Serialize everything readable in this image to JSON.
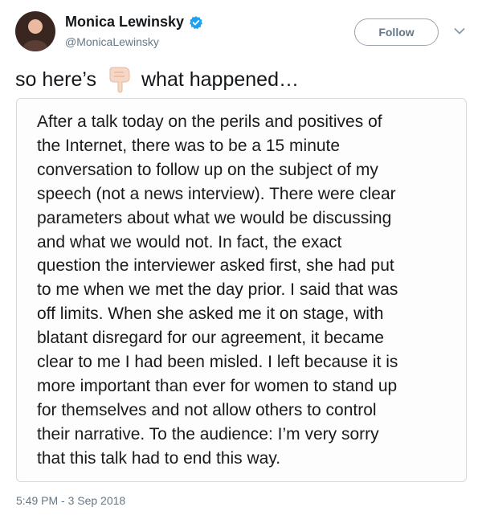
{
  "user": {
    "display_name": "Monica Lewinsky",
    "handle": "@MonicaLewinsky",
    "verified": true
  },
  "follow_button": {
    "label": "Follow"
  },
  "tweet": {
    "text_before": "so here’s",
    "emoji": "backhand-index-pointing-down",
    "text_after": "what happened…",
    "timestamp": "5:49 PM - 3 Sep 2018"
  },
  "statement": {
    "lines": [
      "After a talk today on the perils and positives of",
      "the Internet, there was to be a 15 minute",
      "conversation to follow up on the subject of my",
      "speech (not a news interview). There were clear",
      "parameters about what we would be discussing",
      "and what we would not. In fact, the exact",
      "question the interviewer asked first, she had put",
      "to me when we met the day prior. I said that was",
      "off limits. When she asked me it on stage, with",
      "blatant disregard for our agreement, it became",
      "clear to me I had been misled. I left because it is",
      "more important than ever for women to stand up",
      "for themselves and not allow others to control",
      "their narrative. To the audience: I’m very sorry",
      "that this talk had to end this way."
    ]
  },
  "colors": {
    "verified_blue": "#1da1f2",
    "secondary_text": "#657786",
    "card_border": "#d5dbe1"
  },
  "icons": [
    "verified-badge-icon",
    "chevron-down-icon",
    "pointing-down-icon"
  ]
}
